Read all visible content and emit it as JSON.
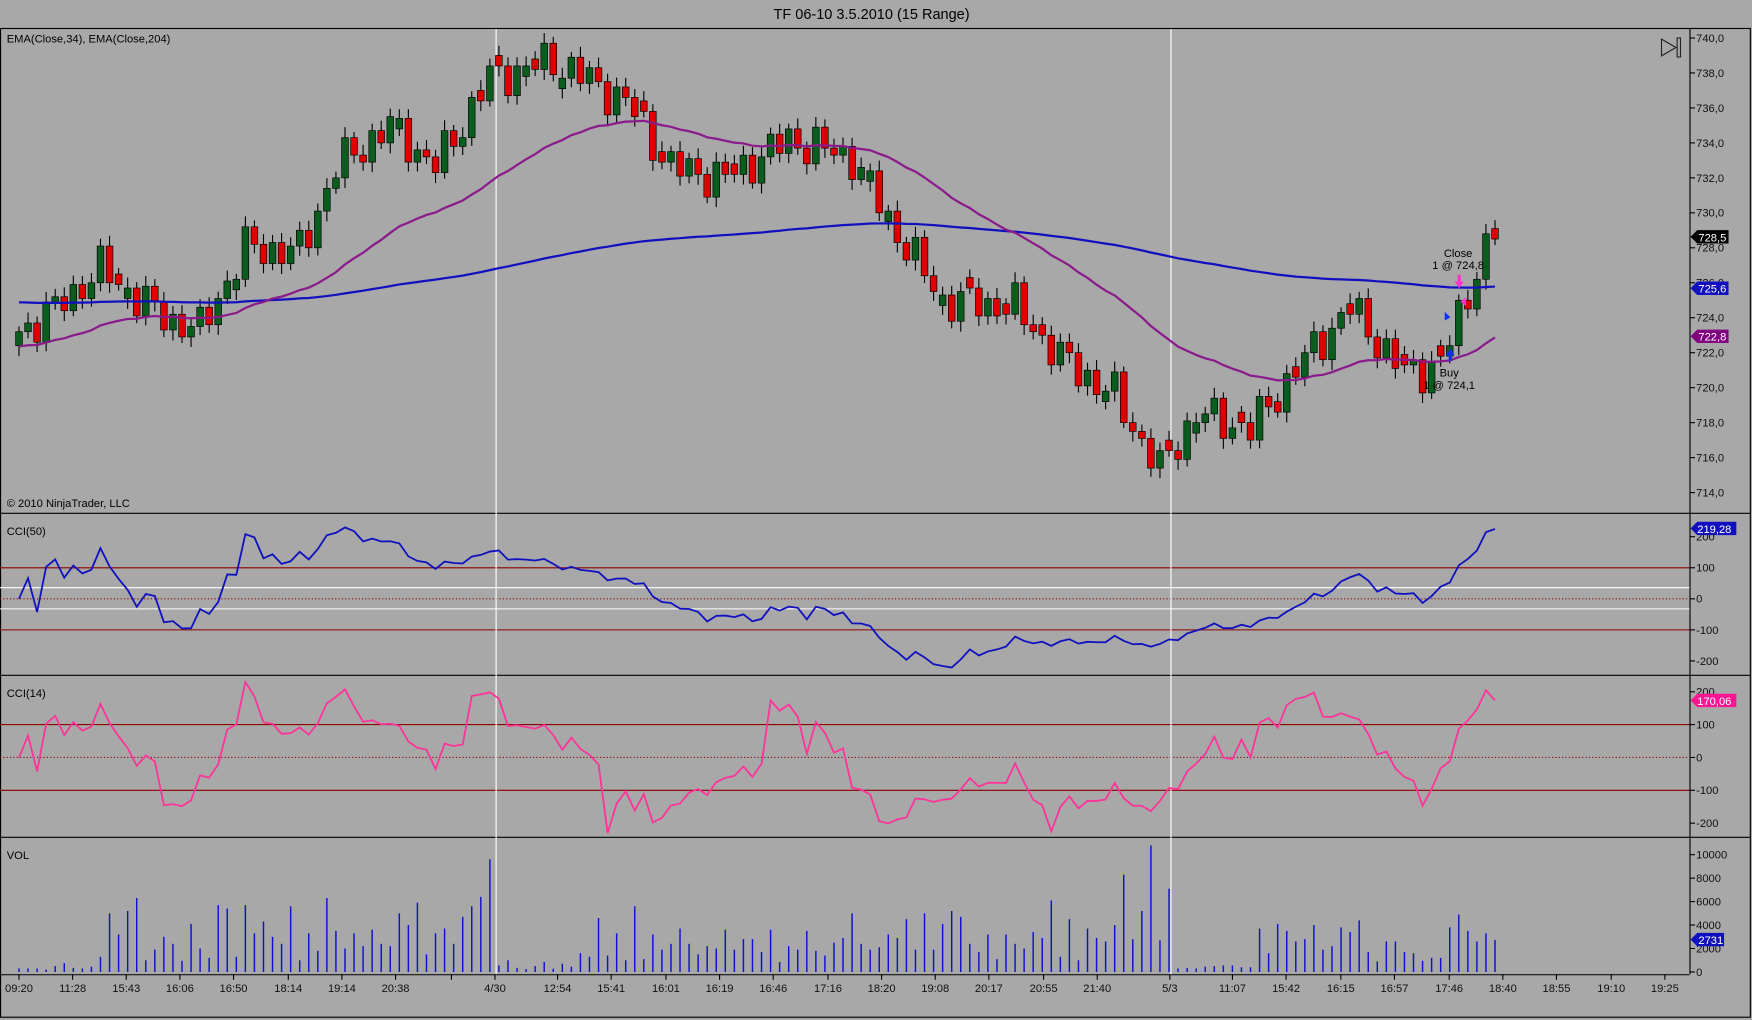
{
  "window": {
    "title": "TF 06-10  3.5.2010 (15 Range)"
  },
  "colors": {
    "background": "#a8a8a8",
    "up": "#0b5d1e",
    "down": "#e00000",
    "ema34": "#8b1a8b",
    "ema204": "#1010c0",
    "cci50": "#1010c0",
    "cci14": "#ff3399",
    "volume": "#1010d0",
    "level": "#8b0000"
  },
  "price_panel": {
    "label": "EMA(Close,34), EMA(Close,204)",
    "copyright": "© 2010 NinjaTrader, LLC",
    "axis_ticks": [
      "740,0",
      "738,0",
      "736,0",
      "734,0",
      "732,0",
      "730,0",
      "728,0",
      "726,0",
      "724,0",
      "722,0",
      "720,0",
      "718,0",
      "716,0",
      "714,0"
    ],
    "last_price_tag": "728,5",
    "ema204_tag": "725,6",
    "ema34_tag": "722,8",
    "orders": {
      "buy_label": "Buy",
      "buy_detail": "1 @ 724,1",
      "close_label": "Close",
      "close_detail": "1 @ 724,8"
    }
  },
  "cci50_panel": {
    "label": "CCI(50)",
    "axis_ticks": [
      "200",
      "100",
      "0",
      "-100",
      "-200"
    ],
    "last_tag": "219,28"
  },
  "cci14_panel": {
    "label": "CCI(14)",
    "axis_ticks": [
      "200",
      "100",
      "0",
      "-100",
      "-200"
    ],
    "last_tag": "170,06"
  },
  "vol_panel": {
    "label": "VOL",
    "axis_ticks": [
      "10000",
      "8000",
      "6000",
      "4000",
      "2000",
      "0"
    ],
    "last_tag": "2731"
  },
  "time_axis": [
    "09:20",
    "11:28",
    "15:43",
    "16:06",
    "16:50",
    "18:14",
    "19:14",
    "20:38",
    "",
    "4/30",
    "12:54",
    "15:41",
    "16:01",
    "16:19",
    "16:46",
    "17:16",
    "18:20",
    "19:08",
    "20:17",
    "20:55",
    "21:40",
    "5/3",
    "11:07",
    "15:42",
    "16:15",
    "16:57",
    "17:46",
    "18:40",
    "18:55",
    "19:10",
    "19:25"
  ],
  "chart_data": {
    "type": "candlestick",
    "title": "TF 06-10  3.5.2010 (15 Range)",
    "bar_range_points": 1.5,
    "price_ylim": [
      713,
      740.5
    ],
    "close_waypoints": [
      [
        0,
        723.2
      ],
      [
        4,
        724.5
      ],
      [
        9,
        726.8
      ],
      [
        13,
        725.2
      ],
      [
        16,
        724
      ],
      [
        20,
        723.3
      ],
      [
        25,
        728
      ],
      [
        31,
        727.8
      ],
      [
        35,
        732.6
      ],
      [
        41,
        735
      ],
      [
        46,
        732.6
      ],
      [
        52,
        737.7
      ],
      [
        59,
        738.7
      ],
      [
        67,
        736.4
      ],
      [
        72,
        732.6
      ],
      [
        78,
        732
      ],
      [
        85,
        734.2
      ],
      [
        92,
        733.2
      ],
      [
        97,
        728.8
      ],
      [
        102,
        725
      ],
      [
        110,
        724.6
      ],
      [
        115,
        721.7
      ],
      [
        121,
        719.5
      ],
      [
        126,
        715.3
      ],
      [
        130,
        718.5
      ],
      [
        136,
        717.6
      ],
      [
        141,
        721
      ],
      [
        147,
        724.6
      ],
      [
        153,
        720.8
      ],
      [
        157,
        721.4
      ],
      [
        160,
        725.2
      ],
      [
        162,
        728.8
      ],
      [
        163,
        728.5
      ]
    ],
    "volume": [
      300,
      300,
      300,
      200,
      500,
      750,
      350,
      300,
      450,
      1300,
      5000,
      3200,
      5200,
      6300,
      1000,
      1900,
      3000,
      2400,
      950,
      4100,
      2000,
      1200,
      5700,
      5400,
      1300,
      5700,
      3300,
      4300,
      3000,
      2400,
      5600,
      1000,
      3300,
      1800,
      6300,
      3500,
      2000,
      3300,
      2200,
      3600,
      2400,
      2200,
      5000,
      4000,
      5900,
      1500,
      3300,
      3700,
      2400,
      4700,
      5600,
      6400,
      9600,
      550,
      1000,
      350,
      250,
      500,
      850,
      280,
      700,
      450,
      1600,
      1300,
      4600,
      1400,
      3300,
      1000,
      5600,
      1100,
      3200,
      1900,
      2400,
      3700,
      2400,
      1500,
      2200,
      2000,
      3600,
      1900,
      2800,
      2800,
      1700,
      3600,
      850,
      2200,
      1900,
      3500,
      1800,
      1400,
      2500,
      2900,
      5000,
      2400,
      1900,
      2100,
      3200,
      2900,
      4500,
      1900,
      5000,
      1900,
      4100,
      5200,
      4700,
      2400,
      1700,
      3200,
      1100,
      3200,
      2400,
      2000,
      3400,
      2900,
      6100,
      1300,
      4500,
      1000,
      3700,
      2900,
      2600,
      4000,
      8300,
      2800,
      5200,
      10800,
      2700,
      7100,
      300,
      350,
      300,
      450,
      500,
      550,
      550,
      400,
      400,
      3700,
      1600,
      4100,
      3500,
      2600,
      2800,
      4000,
      1900,
      2200,
      3800,
      3400,
      4400,
      1700,
      900,
      2600,
      2600,
      1700,
      1600,
      950,
      1200,
      1200,
      3800,
      4900,
      3500,
      2600,
      3300,
      2731
    ],
    "indicators": [
      "EMA(Close,34)",
      "EMA(Close,204)",
      "CCI(50)",
      "CCI(14)",
      "VOL"
    ],
    "cci_levels": [
      100,
      0,
      -100
    ]
  }
}
